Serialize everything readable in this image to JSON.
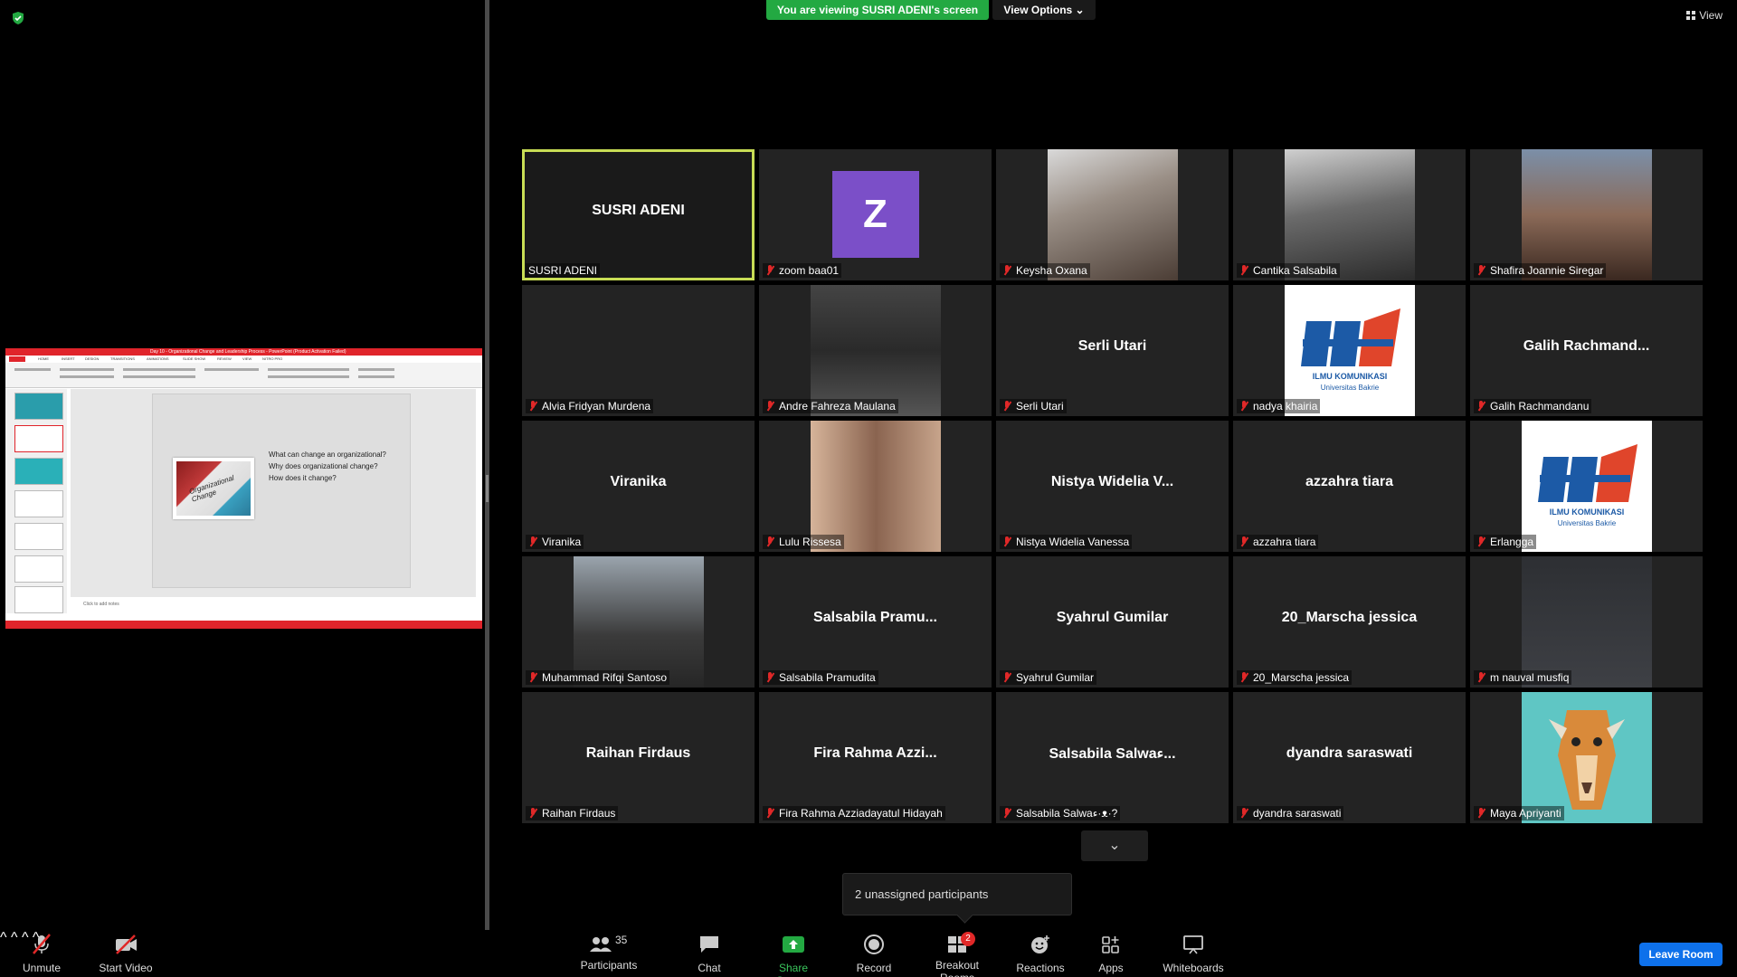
{
  "banner": {
    "viewing_text": "You are viewing SUSRI ADENI's screen",
    "view_options": "View Options ⌄"
  },
  "top_right": {
    "view_label": "View"
  },
  "presentation": {
    "window_title": "Day 10 - Organizational Change and Leadership Process - PowerPoint (Product Activation Failed)",
    "tabs": [
      "FILE",
      "HOME",
      "INSERT",
      "DESIGN",
      "TRANSITIONS",
      "ANIMATIONS",
      "SLIDE SHOW",
      "REVIEW",
      "VIEW",
      "NITRO PRO"
    ],
    "slide_image_text": "Organizational Change",
    "slide_lines": [
      "What can change an organizational?",
      "Why does organizational change?",
      "How does it change?"
    ],
    "notes_text": "Click to add notes"
  },
  "gallery": {
    "tiles": [
      {
        "display": "SUSRI ADENI",
        "label": "SUSRI ADENI",
        "muted": false,
        "active": true,
        "kind": "name"
      },
      {
        "display": "Z",
        "label": "zoom baa01",
        "muted": true,
        "kind": "avatar"
      },
      {
        "display": "",
        "label": "Keysha Oxana",
        "muted": true,
        "kind": "photo"
      },
      {
        "display": "",
        "label": "Cantika Salsabila",
        "muted": true,
        "kind": "photo"
      },
      {
        "display": "",
        "label": "Shafira Joannie Siregar",
        "muted": true,
        "kind": "photo"
      },
      {
        "display": "",
        "label": "Alvia Fridyan Murdena",
        "muted": true,
        "kind": "blank"
      },
      {
        "display": "",
        "label": "Andre Fahreza Maulana",
        "muted": true,
        "kind": "photo"
      },
      {
        "display": "Serli Utari",
        "label": "Serli Utari",
        "muted": true,
        "kind": "name"
      },
      {
        "display": "",
        "label": "nadya khairia",
        "muted": true,
        "kind": "logo"
      },
      {
        "display": "Galih Rachmand...",
        "label": "Galih Rachmandanu",
        "muted": true,
        "kind": "name"
      },
      {
        "display": "Viranika",
        "label": "Viranika",
        "muted": true,
        "kind": "name"
      },
      {
        "display": "",
        "label": "Lulu Rissesa",
        "muted": true,
        "kind": "photo"
      },
      {
        "display": "Nistya Widelia V...",
        "label": "Nistya Widelia Vanessa",
        "muted": true,
        "kind": "name"
      },
      {
        "display": "azzahra tiara",
        "label": "azzahra tiara",
        "muted": true,
        "kind": "name"
      },
      {
        "display": "",
        "label": "Erlangga",
        "muted": true,
        "kind": "logo"
      },
      {
        "display": "",
        "label": "Muhammad Rifqi Santoso",
        "muted": true,
        "kind": "photo"
      },
      {
        "display": "Salsabila Pramu...",
        "label": "Salsabila Pramudita",
        "muted": true,
        "kind": "name"
      },
      {
        "display": "Syahrul Gumilar",
        "label": "Syahrul Gumilar",
        "muted": true,
        "kind": "name"
      },
      {
        "display": "20_Marscha jessica",
        "label": "20_Marscha jessica",
        "muted": true,
        "kind": "name"
      },
      {
        "display": "",
        "label": "m nauval musfiq",
        "muted": true,
        "kind": "dark"
      },
      {
        "display": "Raihan Firdaus",
        "label": "Raihan Firdaus",
        "muted": true,
        "kind": "name"
      },
      {
        "display": "Fira Rahma Azzi...",
        "label": "Fira Rahma Azziadayatul Hidayah",
        "muted": true,
        "kind": "name"
      },
      {
        "display": "Salsabila Salwaء...",
        "label": "Salsabila Salwaء·ᴥ·?",
        "muted": true,
        "kind": "name"
      },
      {
        "display": "dyandra saraswati",
        "label": "dyandra saraswati",
        "muted": true,
        "kind": "name"
      },
      {
        "display": "",
        "label": "Maya Apriyanti",
        "muted": true,
        "kind": "giraffe"
      }
    ],
    "logo_text": [
      "ILMU KOMUNIKASI",
      "Universitas Bakrie"
    ]
  },
  "unassigned": {
    "text": "2 unassigned participants"
  },
  "toolbar": {
    "unmute": "Unmute",
    "start_video": "Start Video",
    "participants": "Participants",
    "participants_count": "35",
    "chat": "Chat",
    "share_screen": "Share Screen",
    "record": "Record",
    "breakout_rooms": "Breakout Rooms",
    "breakout_badge": "2",
    "reactions": "Reactions",
    "apps": "Apps",
    "whiteboards": "Whiteboards",
    "leave": "Leave Room"
  },
  "colors": {
    "accent_green": "#23a942",
    "active_border": "#c8dd55",
    "muted_red": "#e02828",
    "leave_blue": "#0e71eb",
    "avatar_purple": "#7b4fc8"
  }
}
